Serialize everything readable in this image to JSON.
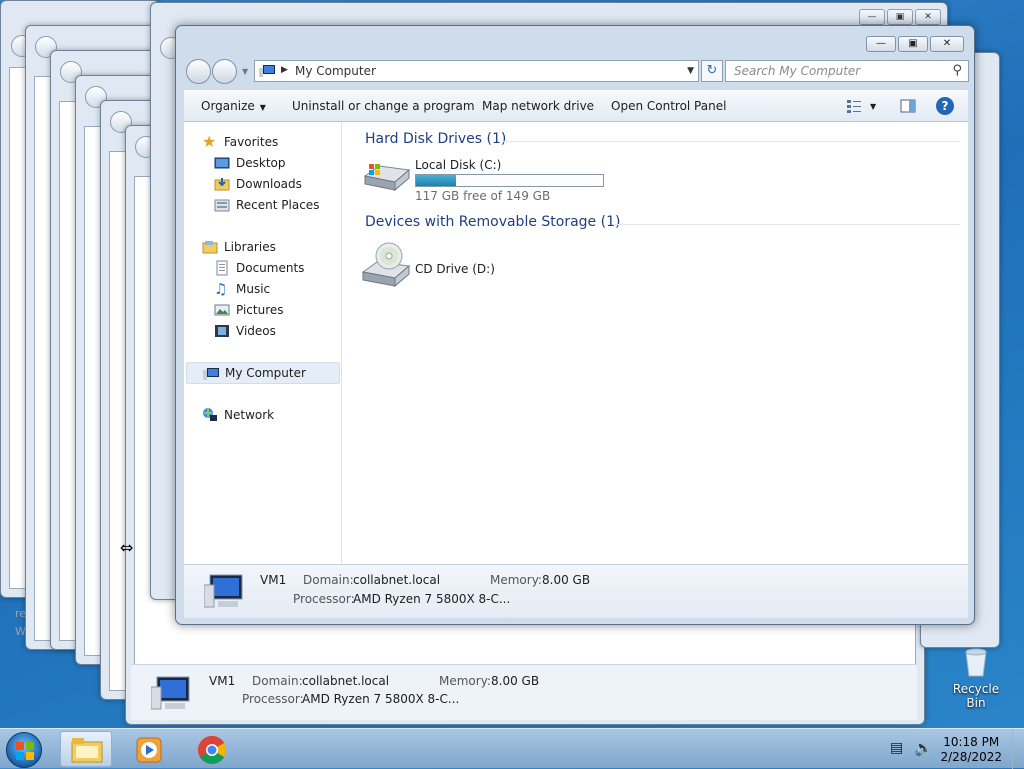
{
  "main_window": {
    "address": "My Computer",
    "search_placeholder": "Search My Computer",
    "toolbar": {
      "organize": "Organize",
      "uninstall": "Uninstall or change a program",
      "map_drive": "Map network drive",
      "control_panel": "Open Control Panel"
    },
    "nav": {
      "favorites": "Favorites",
      "desktop": "Desktop",
      "downloads": "Downloads",
      "recent_places": "Recent Places",
      "libraries": "Libraries",
      "documents": "Documents",
      "music": "Music",
      "pictures": "Pictures",
      "videos": "Videos",
      "my_computer": "My Computer",
      "network": "Network"
    },
    "groups": {
      "hdd": "Hard Disk Drives (1)",
      "removable": "Devices with Removable Storage (1)"
    },
    "drives": {
      "c_label": "Local Disk (C:)",
      "c_free": "117 GB free of 149 GB",
      "c_used_fraction": 0.215,
      "d_label": "CD Drive (D:)"
    },
    "status": {
      "name": "VM1",
      "domain_key": "Domain:",
      "domain_val": "collabnet.local",
      "memory_key": "Memory:",
      "memory_val": "8.00 GB",
      "processor_key": "Processor:",
      "processor_val": "AMD Ryzen 7 5800X 8-C..."
    }
  },
  "background_window_status": {
    "name": "VM1",
    "domain_key": "Domain:",
    "domain_val": "collabnet.local",
    "memory_key": "Memory:",
    "memory_val": "8.00 GB",
    "processor_key": "Processor:",
    "processor_val": "AMD Ryzen 7 5800X 8-C..."
  },
  "background_fragments": {
    "re": "re",
    "windo": "Windo"
  },
  "desktop": {
    "recycle_bin": "Recycle Bin"
  },
  "taskbar": {
    "time": "10:18 PM",
    "date": "2/28/2022"
  },
  "colors": {
    "accent": "#1e3f82",
    "progress": "#1b82b0"
  }
}
